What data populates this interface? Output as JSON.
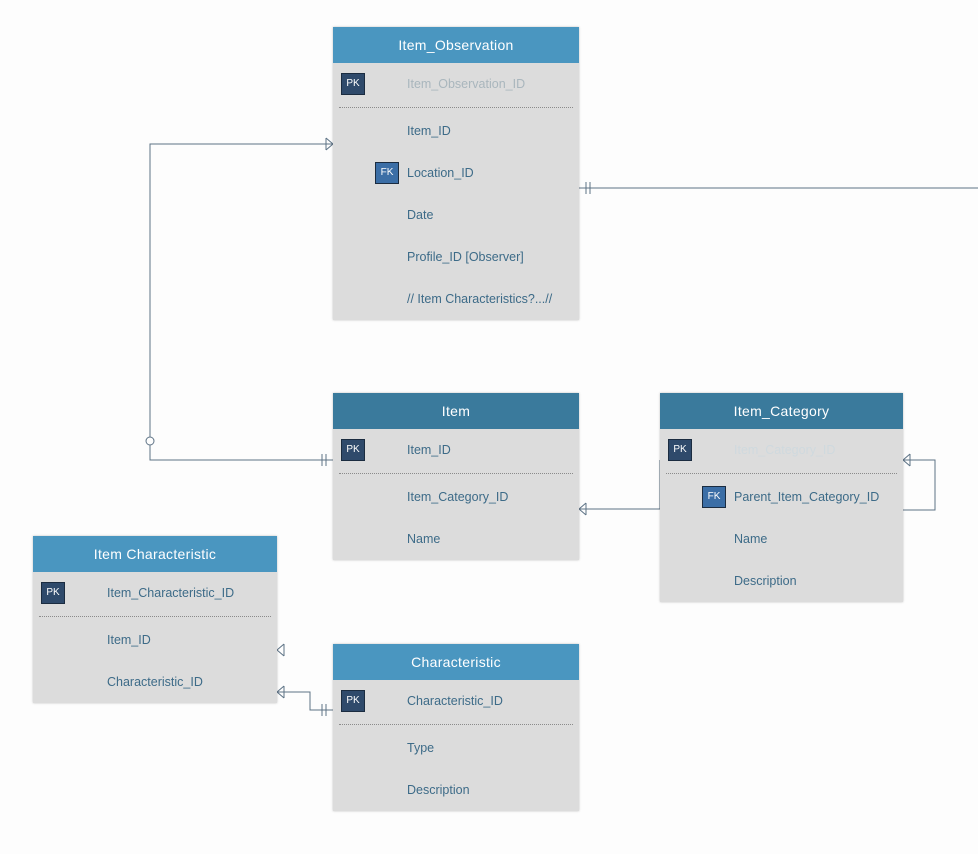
{
  "entities": {
    "item_observation": {
      "title": "Item_Observation",
      "pk_label": "PK",
      "fk_label": "FK",
      "fields": {
        "pk": "Item_Observation_ID",
        "item_id": "Item_ID",
        "location_id": "Location_ID",
        "date": "Date",
        "profile_id": "Profile_ID [Observer]",
        "note": "// Item Characteristics?...//"
      }
    },
    "item": {
      "title": "Item",
      "pk_label": "PK",
      "fields": {
        "pk": "Item_ID",
        "category_id": "Item_Category_ID",
        "name": "Name"
      }
    },
    "item_category": {
      "title": "Item_Category",
      "pk_label": "PK",
      "fk_label": "FK",
      "fields": {
        "pk": "Item_Category_ID",
        "parent": "Parent_Item_Category_ID",
        "name": "Name",
        "description": "Description"
      }
    },
    "item_characteristic": {
      "title": "Item Characteristic",
      "pk_label": "PK",
      "fields": {
        "pk": "Item_Characteristic_ID",
        "item_id": "Item_ID",
        "characteristic_id": "Characteristic_ID"
      }
    },
    "characteristic": {
      "title": "Characteristic",
      "pk_label": "PK",
      "fields": {
        "pk": "Characteristic_ID",
        "type": "Type",
        "description": "Description"
      }
    }
  }
}
